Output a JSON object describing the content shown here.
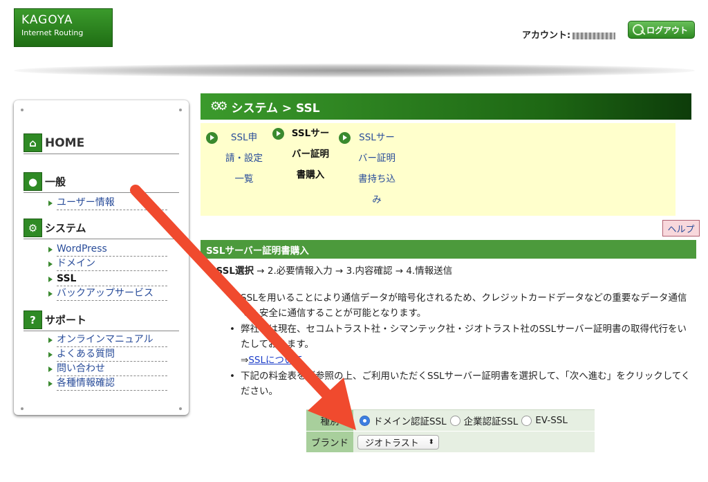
{
  "header": {
    "logo_line1": "KAGOYA",
    "logo_line2": "Internet Routing",
    "account_label": "アカウント:",
    "logout_label": "ログアウト"
  },
  "sidebar": {
    "home": "HOME",
    "general": "一般",
    "general_items": [
      "ユーザー情報"
    ],
    "system": "システム",
    "system_items": [
      "WordPress",
      "ドメイン",
      "SSL",
      "バックアップサービス"
    ],
    "system_current_index": 2,
    "support": "サポート",
    "support_items": [
      "オンラインマニュアル",
      "よくある質問",
      "問い合わせ",
      "各種情報確認"
    ]
  },
  "page": {
    "title": "システム > SSL",
    "steps": [
      {
        "lines": [
          "SSL申",
          "請・設定",
          "一覧"
        ],
        "current": false
      },
      {
        "lines": [
          "SSLサー",
          "バー証明",
          "書購入"
        ],
        "current": true
      },
      {
        "lines": [
          "SSLサー",
          "バー証明",
          "書持ち込",
          "み"
        ],
        "current": false
      }
    ],
    "help_label": "ヘルプ",
    "section_title": "SSLサーバー証明書購入",
    "flow_prefix": "1.",
    "flow_current": "SSL選択",
    "flow_rest": " → 2.必要情報入力 → 3.内容確認 → 4.情報送信",
    "para1": "SSLを用いることにより通信データが暗号化されるため、クレジットカードデータなどの重要なデータ通信でも安全に通信することが可能となります。",
    "para2": "弊社では現在、セコムトラスト社・シマンテック社・ジオトラスト社のSSLサーバー証明書の取得代行をいたしております。",
    "link_prefix": "⇒",
    "link_text": "SSLについて",
    "para3": "下記の料金表をご参照の上、ご利用いただくSSLサーバー証明書を選択して、「次へ進む」をクリックしてください。"
  },
  "form": {
    "type_label": "種別",
    "type_options": [
      "ドメイン認証SSL",
      "企業認証SSL",
      "EV-SSL"
    ],
    "type_selected": 0,
    "brand_label": "ブランド",
    "brand_value": "ジオトラスト"
  },
  "colors": {
    "brand_green": "#2f8a25",
    "annotation_arrow": "#f04a2e"
  }
}
